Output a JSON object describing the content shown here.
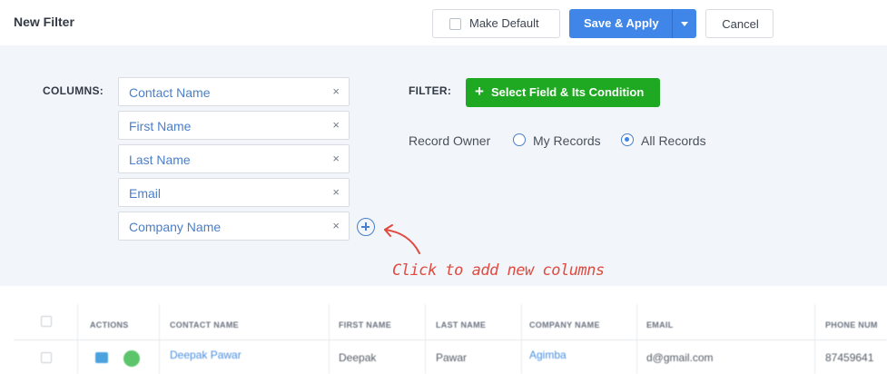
{
  "header": {
    "title": "New Filter",
    "make_default_label": "Make Default",
    "save_apply_label": "Save & Apply",
    "cancel_label": "Cancel"
  },
  "columns": {
    "label": "COLUMNS:",
    "items": [
      {
        "label": "Contact Name",
        "remove": "×"
      },
      {
        "label": "First Name",
        "remove": "×"
      },
      {
        "label": "Last Name",
        "remove": "×"
      },
      {
        "label": "Email",
        "remove": "×"
      },
      {
        "label": "Company Name",
        "remove": "×"
      }
    ],
    "hint": "Click to add new columns"
  },
  "filter": {
    "label": "FILTER:",
    "select_button_label": "Select Field & Its Condition",
    "select_button_icon": "+",
    "record_owner_label": "Record Owner",
    "options": [
      {
        "label": "My Records",
        "selected": false
      },
      {
        "label": "All Records",
        "selected": true
      }
    ]
  },
  "table": {
    "headers": [
      "ACTIONS",
      "CONTACT NAME",
      "FIRST NAME",
      "LAST NAME",
      "COMPANY NAME",
      "EMAIL",
      "PHONE NUM"
    ],
    "row": {
      "contact_name": "Deepak Pawar",
      "first_name": "Deepak",
      "last_name": "Pawar",
      "company_name": "Agimba",
      "email": "d@gmail.com",
      "phone": "87459641"
    }
  },
  "colors": {
    "accent": "#3f86e8",
    "success": "#1fa821",
    "hint": "#e04a3f",
    "panel_bg": "#f2f5f9"
  },
  "icons": [
    "checkbox-icon",
    "caret-down-icon",
    "close-icon",
    "add-circle-icon",
    "plus-icon",
    "mail-icon",
    "chat-icon"
  ]
}
